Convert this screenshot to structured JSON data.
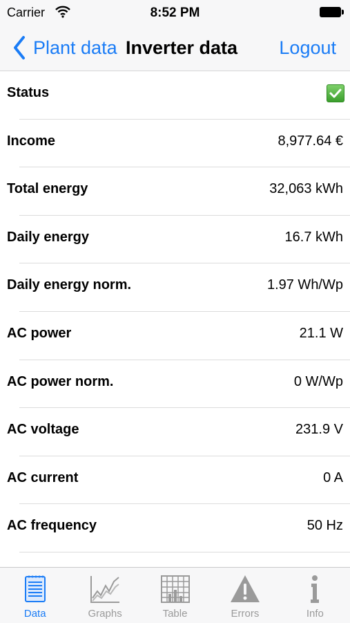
{
  "status_bar": {
    "carrier": "Carrier",
    "time": "8:52 PM"
  },
  "nav": {
    "back_label": "Plant data",
    "title": "Inverter data",
    "logout_label": "Logout"
  },
  "rows": [
    {
      "label": "Status",
      "value": "",
      "status_icon": "check-icon"
    },
    {
      "label": "Income",
      "value": "8,977.64 €"
    },
    {
      "label": "Total energy",
      "value": "32,063 kWh"
    },
    {
      "label": "Daily energy",
      "value": "16.7 kWh"
    },
    {
      "label": "Daily energy norm.",
      "value": "1.97 Wh/Wp"
    },
    {
      "label": "AC power",
      "value": "21.1 W"
    },
    {
      "label": "AC power norm.",
      "value": "0 W/Wp"
    },
    {
      "label": "AC voltage",
      "value": "231.9 V"
    },
    {
      "label": "AC current",
      "value": "0 A"
    },
    {
      "label": "AC frequency",
      "value": "50 Hz"
    }
  ],
  "tabs": [
    {
      "label": "Data",
      "icon": "notepad-icon",
      "active": true
    },
    {
      "label": "Graphs",
      "icon": "line-graph-icon",
      "active": false
    },
    {
      "label": "Table",
      "icon": "table-icon",
      "active": false
    },
    {
      "label": "Errors",
      "icon": "warning-icon",
      "active": false
    },
    {
      "label": "Info",
      "icon": "info-icon",
      "active": false
    }
  ],
  "colors": {
    "accent": "#1a7cf6",
    "inactive": "#9a9a9a",
    "status_ok": "#4caf3a"
  }
}
